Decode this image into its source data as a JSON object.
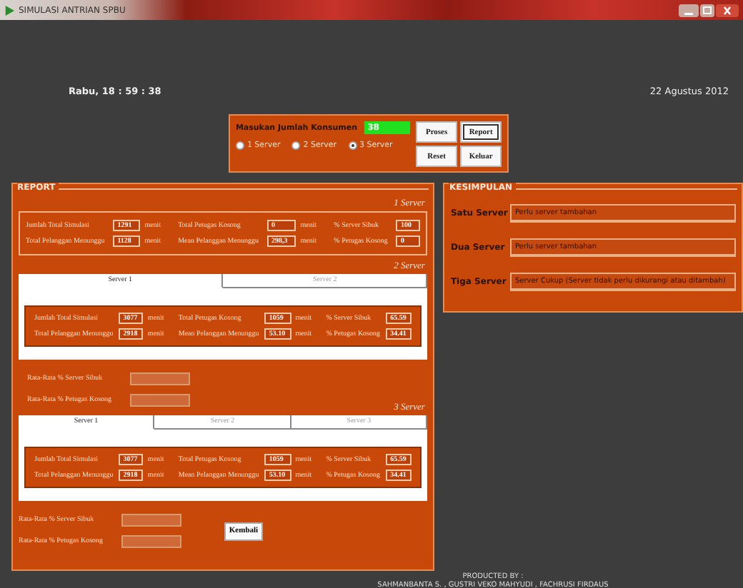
{
  "window": {
    "title": "SIMULASI ANTRIAN SPBU"
  },
  "clock": {
    "time": "Rabu, 18 : 59 : 38",
    "date": "22 Agustus 2012"
  },
  "input_panel": {
    "label": "Masukan Jumlah Konsumen",
    "value": "38",
    "radios": [
      {
        "label": "1 Server",
        "selected": false
      },
      {
        "label": "2 Server",
        "selected": false
      },
      {
        "label": "3 Server",
        "selected": true
      }
    ],
    "buttons": [
      {
        "label": "Proses",
        "focused": false
      },
      {
        "label": "Report",
        "focused": true
      },
      {
        "label": "Reset",
        "focused": false
      },
      {
        "label": "Keluar",
        "focused": false
      }
    ]
  },
  "report": {
    "title": "REPORT",
    "sections": [
      {
        "label": "1 Server",
        "fields": [
          {
            "label": "Jumlah Total Simulasi",
            "value": "1291",
            "unit": "menit"
          },
          {
            "label": "Total Petugas Kosong",
            "value": "0",
            "unit": "menit"
          },
          {
            "label": "% Server Sibuk",
            "value": "100"
          },
          {
            "label": "Total Pelanggan Menunggu",
            "value": "1128",
            "unit": "menit"
          },
          {
            "label": "Mean Pelanggan Menunggu",
            "value": "298,3",
            "unit": "menit"
          },
          {
            "label": "% Petugas Kosong",
            "value": "0"
          }
        ]
      },
      {
        "label": "2 Server",
        "tabs": [
          {
            "label": "Server 1",
            "selected": true
          },
          {
            "label": "Server 2",
            "selected": false
          }
        ],
        "fields": [
          {
            "label": "Jumlah Total Simulasi",
            "value": "3077",
            "unit": "menit"
          },
          {
            "label": "Total Petugas Kosong",
            "value": "1059",
            "unit": "menit"
          },
          {
            "label": "% Server Sibuk",
            "value": "65.59"
          },
          {
            "label": "Total Pelanggan Menunggu",
            "value": "2918",
            "unit": "menit"
          },
          {
            "label": "Mean Pelanggan Menunggu",
            "value": "53.10",
            "unit": "menit"
          },
          {
            "label": "% Petugas Kosong",
            "value": "34.41"
          }
        ],
        "averages": [
          {
            "label": "Rata-Rata % Server Sibuk"
          },
          {
            "label": "Rata-Rata % Petugas Kosong"
          }
        ]
      },
      {
        "label": "3 Server",
        "tabs": [
          {
            "label": "Server 1",
            "selected": true
          },
          {
            "label": "Server 2",
            "selected": false
          },
          {
            "label": "Server 3",
            "selected": false
          }
        ],
        "fields": [
          {
            "label": "Jumlah Total Simulasi",
            "value": "3077",
            "unit": "menit"
          },
          {
            "label": "Total Petugas Kosong",
            "value": "1059",
            "unit": "menit"
          },
          {
            "label": "% Server Sibuk",
            "value": "65.59"
          },
          {
            "label": "Total Pelanggan Menunggu",
            "value": "2918",
            "unit": "menit"
          },
          {
            "label": "Mean Pelanggan Menunggu",
            "value": "53.10",
            "unit": "menit"
          },
          {
            "label": "% Petugas Kosong",
            "value": "34.41"
          }
        ],
        "averages": [
          {
            "label": "Rata-Rata % Server Sibuk"
          },
          {
            "label": "Rata-Rata % Petugas Kosong"
          }
        ]
      }
    ],
    "back_button": "Kembali"
  },
  "conclusion": {
    "title": "KESIMPULAN",
    "rows": [
      {
        "label": "Satu Server",
        "value": "Perlu server tambahan"
      },
      {
        "label": "Dua Server",
        "value": "Perlu server tambahan"
      },
      {
        "label": "Tiga Server",
        "value": "Server Cukup (Server tidak perlu dikurangi atau ditambah)"
      }
    ]
  },
  "footer": {
    "line_1": "PRODUCTED BY :",
    "line_2": "SAHMANBANTA S. , GUSTRI VEKO MAHYUDI , FACHRUSI FIRDAUS"
  }
}
